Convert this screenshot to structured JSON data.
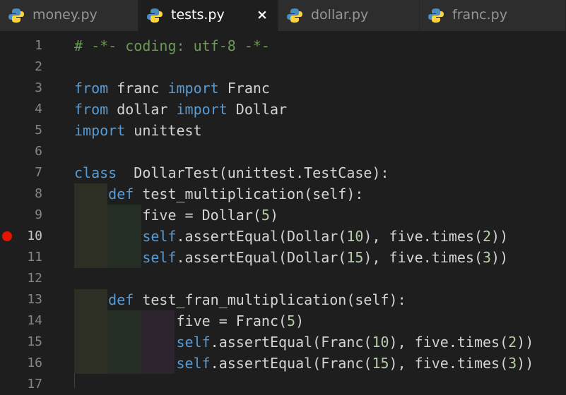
{
  "tabs": [
    {
      "label": "money.py",
      "active": false
    },
    {
      "label": "tests.py",
      "active": true,
      "close": "×"
    },
    {
      "label": "dollar.py",
      "active": false
    },
    {
      "label": "franc.py",
      "active": false
    }
  ],
  "gutter": {
    "line_numbers": [
      "1",
      "2",
      "3",
      "4",
      "5",
      "6",
      "7",
      "8",
      "9",
      "10",
      "11",
      "12",
      "13",
      "14",
      "15",
      "16",
      "17"
    ],
    "breakpoint_line": "10"
  },
  "code_lines": [
    [
      {
        "t": "# -*- coding: utf-8 -*-",
        "c": "cm"
      }
    ],
    [],
    [
      {
        "t": "from",
        "c": "kw"
      },
      {
        "t": " franc "
      },
      {
        "t": "import",
        "c": "kw"
      },
      {
        "t": " Franc"
      }
    ],
    [
      {
        "t": "from",
        "c": "kw"
      },
      {
        "t": " dollar "
      },
      {
        "t": "import",
        "c": "kw"
      },
      {
        "t": " Dollar"
      }
    ],
    [
      {
        "t": "import",
        "c": "kw"
      },
      {
        "t": " unittest"
      }
    ],
    [],
    [
      {
        "t": "class",
        "c": "kw"
      },
      {
        "t": "  DollarTest(unittest.TestCase):"
      }
    ],
    [
      {
        "t": "    "
      },
      {
        "t": "def",
        "c": "kw"
      },
      {
        "t": " test_multiplication(self):"
      }
    ],
    [
      {
        "t": "        five = Dollar("
      },
      {
        "t": "5",
        "c": "nm"
      },
      {
        "t": ")"
      }
    ],
    [
      {
        "t": "        "
      },
      {
        "t": "self",
        "c": "kw"
      },
      {
        "t": ".assertEqual(Dollar("
      },
      {
        "t": "10",
        "c": "nm"
      },
      {
        "t": "), five.times("
      },
      {
        "t": "2",
        "c": "nm"
      },
      {
        "t": "))"
      }
    ],
    [
      {
        "t": "        "
      },
      {
        "t": "self",
        "c": "kw"
      },
      {
        "t": ".assertEqual(Dollar("
      },
      {
        "t": "15",
        "c": "nm"
      },
      {
        "t": "), five.times("
      },
      {
        "t": "3",
        "c": "nm"
      },
      {
        "t": "))"
      }
    ],
    [],
    [
      {
        "t": "    "
      },
      {
        "t": "def",
        "c": "kw"
      },
      {
        "t": " test_fran_multiplication(self):"
      }
    ],
    [
      {
        "t": "            five = Franc("
      },
      {
        "t": "5",
        "c": "nm"
      },
      {
        "t": ")"
      }
    ],
    [
      {
        "t": "            "
      },
      {
        "t": "self",
        "c": "kw"
      },
      {
        "t": ".assertEqual(Franc("
      },
      {
        "t": "10",
        "c": "nm"
      },
      {
        "t": "), five.times("
      },
      {
        "t": "2",
        "c": "nm"
      },
      {
        "t": "))"
      }
    ],
    [
      {
        "t": "            "
      },
      {
        "t": "self",
        "c": "kw"
      },
      {
        "t": ".assertEqual(Franc("
      },
      {
        "t": "15",
        "c": "nm"
      },
      {
        "t": "), five.times("
      },
      {
        "t": "3",
        "c": "nm"
      },
      {
        "t": "))"
      }
    ],
    []
  ],
  "colors": {
    "keyword": "#569cd6",
    "comment": "#6a9955",
    "number": "#b5cea8",
    "text": "#d4d4d4",
    "breakpoint": "#e51400"
  }
}
